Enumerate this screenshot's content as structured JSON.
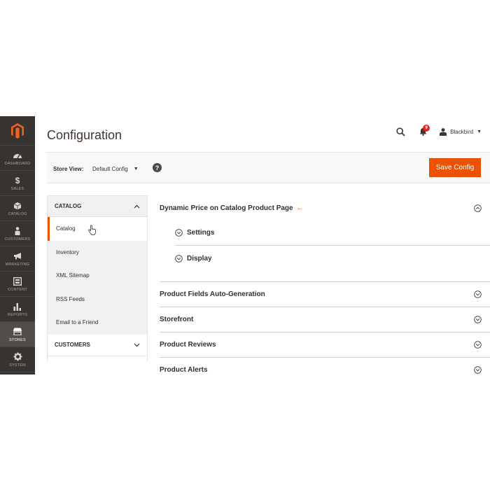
{
  "nav": {
    "items": [
      {
        "label": "DASHBOARD",
        "icon": "dashboard-icon"
      },
      {
        "label": "SALES",
        "icon": "dollar-icon"
      },
      {
        "label": "CATALOG",
        "icon": "box-icon"
      },
      {
        "label": "CUSTOMERS",
        "icon": "person-icon"
      },
      {
        "label": "MARKETING",
        "icon": "megaphone-icon"
      },
      {
        "label": "CONTENT",
        "icon": "layout-icon"
      },
      {
        "label": "REPORTS",
        "icon": "bar-chart-icon"
      },
      {
        "label": "STORES",
        "icon": "store-icon"
      },
      {
        "label": "SYSTEM",
        "icon": "gear-icon"
      }
    ],
    "active": "STORES",
    "accent": "#eb5202"
  },
  "header": {
    "title": "Configuration",
    "notifications_count": "9",
    "user_name": "Blackbird"
  },
  "store_view": {
    "label": "Store View:",
    "value": "Default Config",
    "help": "?"
  },
  "toolbar": {
    "save_label": "Save Config"
  },
  "tabs": {
    "catalog_title": "CATALOG",
    "items": [
      "Catalog",
      "Inventory",
      "XML Sitemap",
      "RSS Feeds",
      "Email to a Friend"
    ],
    "active_item": "Catalog",
    "customers_title": "CUSTOMERS"
  },
  "sections": {
    "first": {
      "title": "Dynamic Price on Catalog Product Page",
      "groups": [
        "Settings",
        "Display"
      ]
    },
    "others": [
      "Product Fields Auto-Generation",
      "Storefront",
      "Product Reviews",
      "Product Alerts"
    ]
  }
}
